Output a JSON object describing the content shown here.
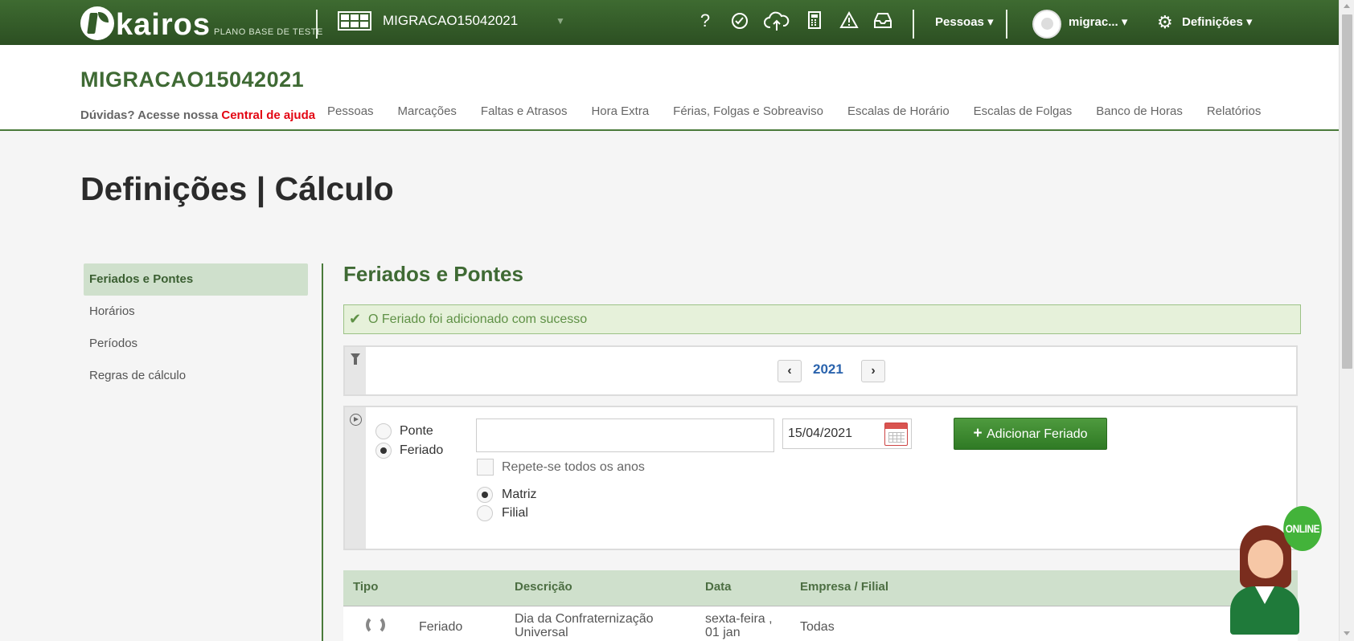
{
  "topbar": {
    "logo_text": "kairos",
    "logo_subtitle": "PLANO BASE DE TESTE",
    "company_selector": "MIGRACAO15042021",
    "icons": [
      "help-icon",
      "clock-check-icon",
      "cloud-upload-icon",
      "calculator-icon",
      "warning-icon",
      "inbox-icon"
    ],
    "people_menu": "Pessoas",
    "user_menu": "migrac...",
    "settings_menu": "Definições"
  },
  "header": {
    "company_title": "MIGRACAO15042021",
    "help_prefix": "Dúvidas? Acesse nossa",
    "help_link": "Central de ajuda",
    "nav": [
      "Pessoas",
      "Marcações",
      "Faltas e Atrasos",
      "Hora Extra",
      "Férias, Folgas e Sobreaviso",
      "Escalas de Horário",
      "Escalas de Folgas",
      "Banco de Horas",
      "Relatórios"
    ]
  },
  "page": {
    "title": "Definições | Cálculo",
    "sidebar": [
      "Feriados e Pontes",
      "Horários",
      "Períodos",
      "Regras de cálculo"
    ],
    "section_title": "Feriados e Pontes",
    "alert": "O Feriado foi adicionado com sucesso"
  },
  "filter": {
    "year": "2021",
    "prev": "‹",
    "next": "›"
  },
  "form": {
    "type_options": [
      "Ponte",
      "Feriado"
    ],
    "type_selected": "Feriado",
    "description_value": "",
    "date_value": "15/04/2021",
    "add_button": "Adicionar Feriado",
    "repeat_label": "Repete-se todos os anos",
    "scope_options": [
      "Matriz",
      "Filial"
    ],
    "scope_selected": "Matriz"
  },
  "table": {
    "headers": [
      "Tipo",
      "Descrição",
      "Data",
      "Empresa / Filial"
    ],
    "rows": [
      {
        "tipo": "Feriado",
        "descricao": "Dia da Confraternização Universal",
        "data": "sexta-feira , 01 jan",
        "empresa": "Todas"
      }
    ]
  },
  "widget": {
    "label": "ONLINE"
  },
  "colors": {
    "brand_green": "#3f6a34",
    "accent_red": "#e30613",
    "button_green": "#3f8a30",
    "year_blue": "#2a63ad"
  }
}
